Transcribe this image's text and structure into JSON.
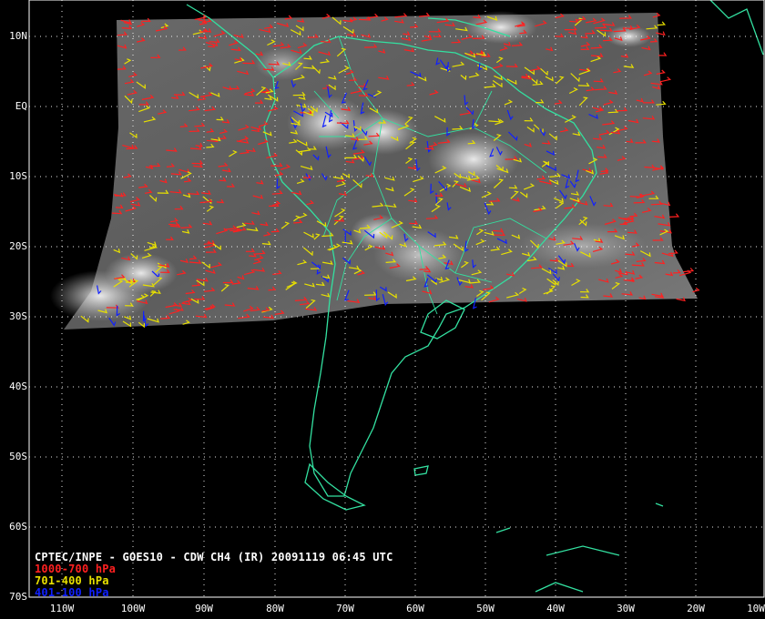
{
  "map": {
    "title": "CPTEC/INPE - GOES10 - CDW CH4 (IR) 20091119 06:45 UTC",
    "projection": "lat-lon",
    "lat_range": [
      "70S",
      "10N+"
    ],
    "lon_range": [
      "110W+",
      "10W"
    ],
    "colors": {
      "background": "#000000",
      "coastline": "#33e0a0",
      "grid": "#ffffff",
      "low_level": "#ff2020",
      "mid_level": "#e8e000",
      "high_level": "#1020ff"
    }
  },
  "axes": {
    "lat_ticks": [
      "10N",
      "EQ",
      "10S",
      "20S",
      "30S",
      "40S",
      "50S",
      "60S",
      "70S"
    ],
    "lon_ticks": [
      "110W",
      "100W",
      "90W",
      "80W",
      "70W",
      "60W",
      "50W",
      "40W",
      "30W",
      "20W",
      "10W"
    ]
  },
  "legend": {
    "items": [
      {
        "label": "1000-700 hPa",
        "color": "#ff2020"
      },
      {
        "label": "701-400 hPa",
        "color": "#e8e000"
      },
      {
        "label": "401-100 hPa",
        "color": "#1020ff"
      }
    ]
  }
}
